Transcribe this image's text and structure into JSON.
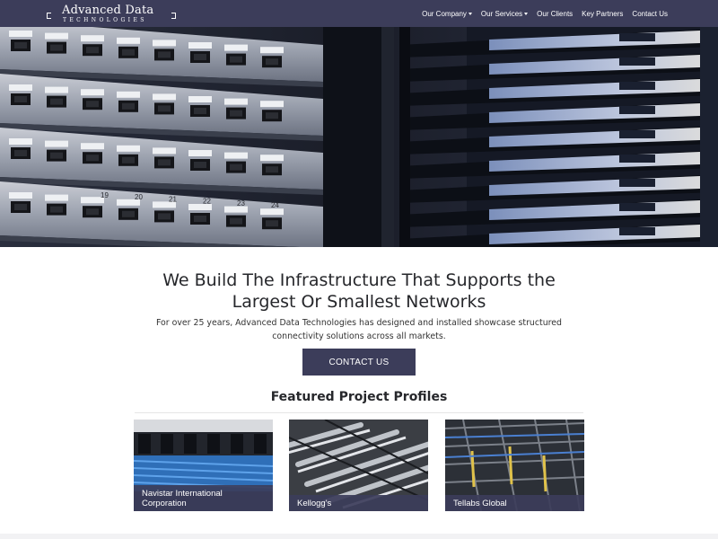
{
  "header": {
    "logo_main": "Advanced Data",
    "logo_sub": "TECHNOLOGIES",
    "nav": [
      {
        "label": "Our Company",
        "dropdown": true
      },
      {
        "label": "Our Services",
        "dropdown": true
      },
      {
        "label": "Our Clients",
        "dropdown": false
      },
      {
        "label": "Key Partners",
        "dropdown": false
      },
      {
        "label": "Contact Us",
        "dropdown": false
      }
    ]
  },
  "hero": {
    "port_labels": [
      "19",
      "20",
      "21",
      "22",
      "23",
      "24"
    ]
  },
  "main": {
    "headline_line1": "We Build The Infrastructure That Supports the",
    "headline_line2": "Largest Or Smallest Networks",
    "sub_line1": "For over 25 years, Advanced Data Technologies has designed and installed showcase structured",
    "sub_line2": "connectivity solutions across all markets.",
    "cta_label": "CONTACT US",
    "featured_title": "Featured Project Profiles"
  },
  "projects": [
    {
      "line1": "Navistar International",
      "line2": "Corporation"
    },
    {
      "line1": "Kellogg's",
      "line2": ""
    },
    {
      "line1": "Tellabs Global",
      "line2": ""
    }
  ],
  "colors": {
    "brand": "#3c3d5a",
    "text": "#26272b",
    "white": "#ffffff"
  },
  "icons": [
    "caret-down-icon"
  ]
}
